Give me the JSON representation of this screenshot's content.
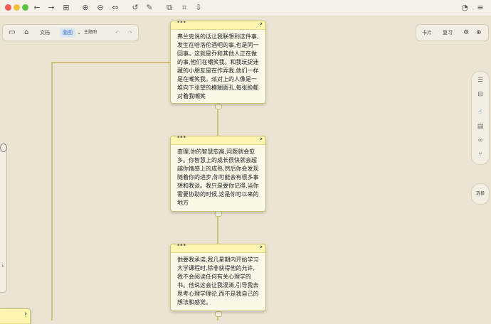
{
  "toolbar": {
    "doc_label": "文档",
    "map_label": "脑图",
    "theme_label": "主题图"
  },
  "right_toolbar": {
    "card_label": "卡片",
    "review_label": "复习"
  },
  "side_panel": {
    "select_label": "选择"
  },
  "cards": [
    {
      "text": "弗兰克说的话让我联想到这件事,发生在哈洛伦酒吧的事,也是同一回事。这就是乔和其他人正在做的事,他们在嘲笑我。和我玩捉迷藏的小朋友是在作弄我,他们一样是在嘲笑我。派对上的人像是一堆向下张望的模糊面孔,每张脸都对着我嘲笑"
    },
    {
      "text": "查理,你的智慧愈高,问题就会愈多。你智慧上的成长很快就会超越你情感上的成熟,然后你会发现随着你的进步,你可能会有很多事想和我谈。我只是要你记得,当你需要协助的时候,这是你可以来的地方"
    },
    {
      "text": "他要我承诺,我几星期内开始学习大学课程时,除非获得他的允许,我不会阅读任何有关心理学的书。他说这会让我混淆,引导我去思考心理学理论,而不是我自己的想法和感觉。"
    }
  ]
}
